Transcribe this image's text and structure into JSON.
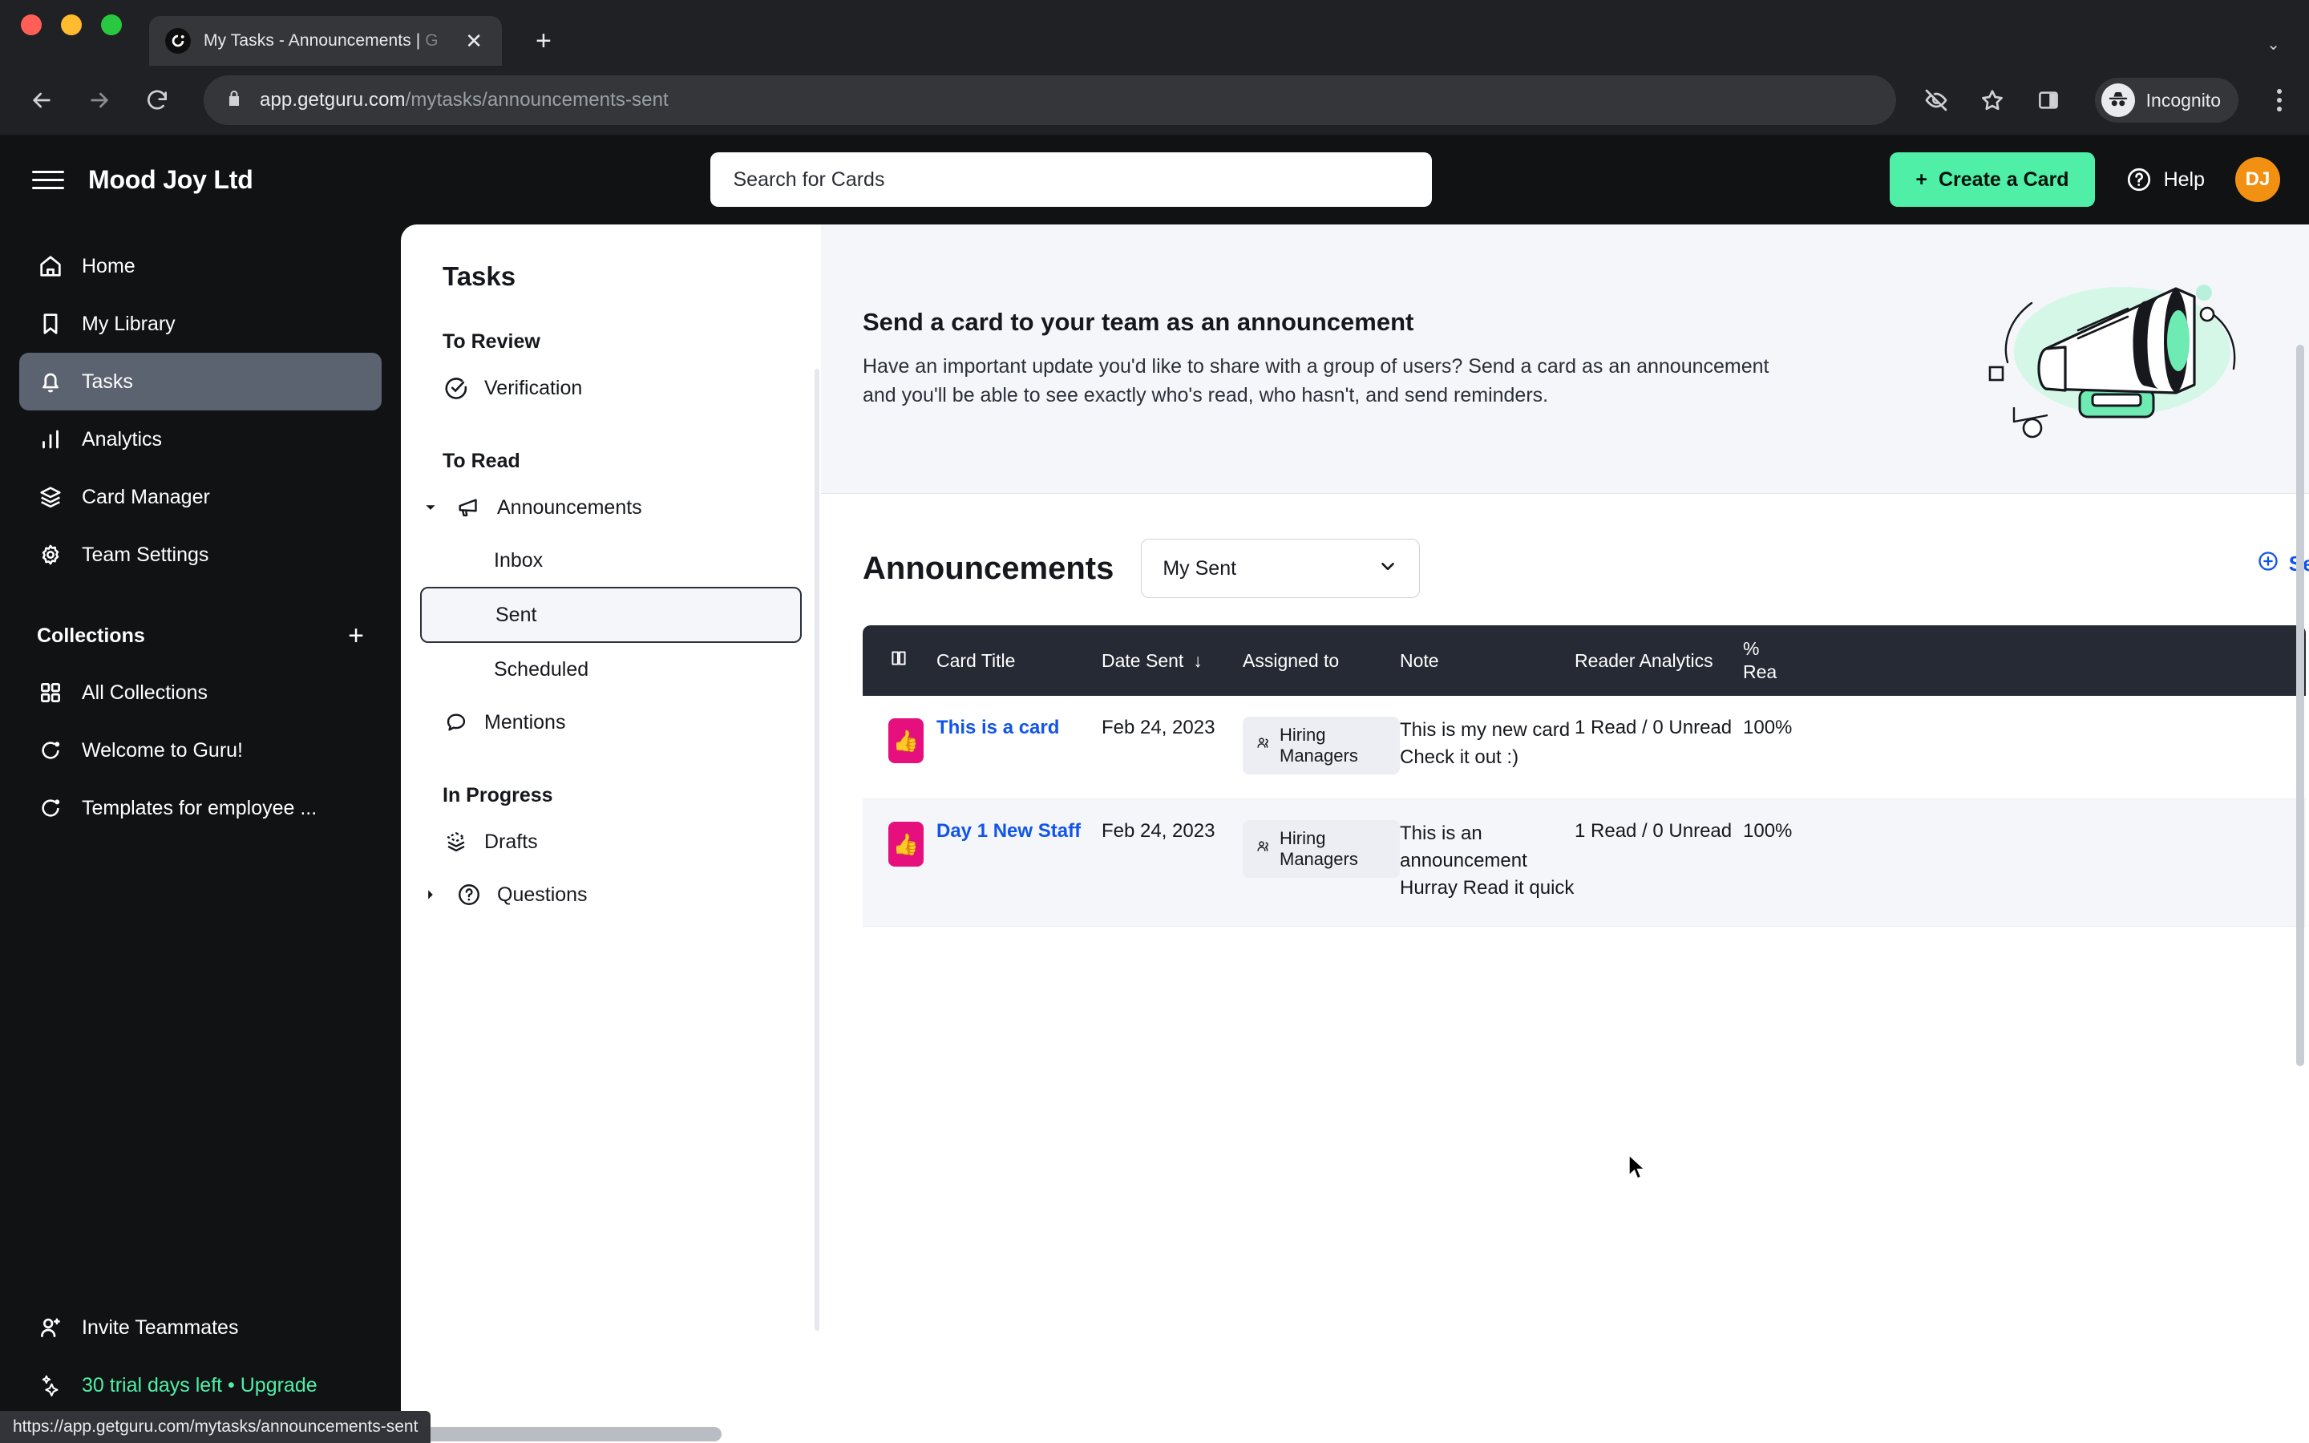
{
  "browser": {
    "tab": {
      "title_main": "My Tasks - Announcements | ",
      "title_dim": "G",
      "favicon": "guru-logo-icon",
      "close": "✕"
    },
    "newtab_label": "+",
    "caret": "⌄",
    "url": {
      "domain": "app.getguru.com",
      "path": "/mytasks/announcements-sent",
      "lock": "lock-icon"
    },
    "toolbar_icons": [
      "eye-slash-icon",
      "star-icon",
      "side-panel-icon"
    ],
    "incognito_label": "Incognito",
    "status_url": "https://app.getguru.com/mytasks/announcements-sent"
  },
  "header": {
    "org_name": "Mood Joy Ltd",
    "search_placeholder": "Search for Cards",
    "create_label": "Create a Card",
    "create_plus": "+",
    "help_label": "Help",
    "avatar_initials": "DJ",
    "accent_green": "#4FEFA8",
    "avatar_color": "#F29111"
  },
  "sidebar": {
    "items": [
      {
        "label": "Home",
        "icon": "home-icon",
        "active": false
      },
      {
        "label": "My Library",
        "icon": "bookmark-icon",
        "active": false
      },
      {
        "label": "Tasks",
        "icon": "bell-icon",
        "active": true
      },
      {
        "label": "Analytics",
        "icon": "bar-chart-icon",
        "active": false
      },
      {
        "label": "Card Manager",
        "icon": "layers-icon",
        "active": false
      },
      {
        "label": "Team Settings",
        "icon": "gear-icon",
        "active": false
      }
    ],
    "collections_title": "Collections",
    "collections_add": "+",
    "collections": [
      {
        "label": "All Collections",
        "icon": "grid-icon"
      },
      {
        "label": "Welcome to Guru!",
        "icon": "guru-logo-icon"
      },
      {
        "label": "Templates for employee ...",
        "icon": "guru-logo-icon"
      }
    ],
    "footer": [
      {
        "label": "Invite Teammates",
        "icon": "person-plus-icon",
        "highlight": false
      },
      {
        "label": "30 trial days left • Upgrade",
        "icon": "sparkles-icon",
        "highlight": true
      }
    ],
    "trial_color": "#4FEFA8"
  },
  "tasks_panel": {
    "title": "Tasks",
    "groups": [
      {
        "title": "To Review",
        "items": [
          {
            "label": "Verification",
            "icon": "check-circle-icon",
            "sub": false,
            "selected": false,
            "caret": ""
          }
        ]
      },
      {
        "title": "To Read",
        "items": [
          {
            "label": "Announcements",
            "icon": "megaphone-icon",
            "sub": false,
            "selected": false,
            "caret": "down"
          },
          {
            "label": "Inbox",
            "icon": "",
            "sub": true,
            "selected": false,
            "caret": ""
          },
          {
            "label": "Sent",
            "icon": "",
            "sub": true,
            "selected": true,
            "caret": ""
          },
          {
            "label": "Scheduled",
            "icon": "",
            "sub": true,
            "selected": false,
            "caret": ""
          },
          {
            "label": "Mentions",
            "icon": "chat-bubble-icon",
            "sub": false,
            "selected": false,
            "caret": ""
          }
        ]
      },
      {
        "title": "In Progress",
        "items": [
          {
            "label": "Drafts",
            "icon": "drafts-layers-icon",
            "sub": false,
            "selected": false,
            "caret": ""
          },
          {
            "label": "Questions",
            "icon": "question-circle-icon",
            "sub": false,
            "selected": false,
            "caret": "right"
          }
        ]
      }
    ]
  },
  "banner": {
    "title": "Send a card to your team as an announcement",
    "description": "Have an important update you'd like to share with a group of users? Send a card as an announcement and you'll be able to see exactly who's read, who hasn't, and send reminders.",
    "illustration": "megaphone-illustration"
  },
  "announcements": {
    "title": "Announcements",
    "filter_value": "My Sent",
    "filter_caret": "chevron-down-icon",
    "send_link_label": "Send a",
    "send_link_icon": "plus-circle-icon",
    "send_link_color": "#1155e8",
    "columns": [
      {
        "label": "",
        "icon": "card-icon"
      },
      {
        "label": "Card Title"
      },
      {
        "label": "Date Sent",
        "sort": "↓"
      },
      {
        "label": "Assigned to"
      },
      {
        "label": "Note"
      },
      {
        "label": "Reader Analytics"
      },
      {
        "label_line1": "%",
        "label_line2": "Rea"
      }
    ],
    "rows": [
      {
        "thumb_emoji": "👍",
        "thumb_color": "#E5107E",
        "title": "This is a card",
        "date": "Feb 24, 2023",
        "assigned": "Hiring Managers",
        "assigned_icon": "people-icon",
        "note": "This is my new card Check it out :)",
        "reader_analytics": "1 Read / 0 Unread",
        "percent_read": "100%"
      },
      {
        "thumb_emoji": "👍",
        "thumb_color": "#E5107E",
        "title": "Day 1 New Staff",
        "date": "Feb 24, 2023",
        "assigned": "Hiring Managers",
        "assigned_icon": "people-icon",
        "note": "This is an announcement Hurray Read it quick",
        "reader_analytics": "1 Read / 0 Unread",
        "percent_read": "100%"
      }
    ]
  }
}
